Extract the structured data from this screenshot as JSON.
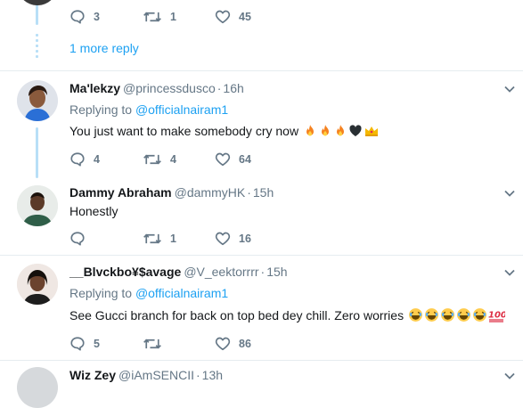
{
  "top_tweet": {
    "counts": {
      "reply": "3",
      "retweet": "1",
      "like": "45"
    },
    "more_reply_label": "1 more reply"
  },
  "tweets": [
    {
      "name": "Ma'lekzy",
      "handle": "@princessdusco",
      "dot": "·",
      "time": "16h",
      "replying_prefix": "Replying to",
      "replying_to": "@officialnairam1",
      "text": "You just want to make somebody cry now",
      "emoji": [
        "fire",
        "fire",
        "fire",
        "black-heart",
        "crown"
      ],
      "counts": {
        "reply": "4",
        "retweet": "4",
        "like": "64"
      }
    },
    {
      "name": "Dammy Abraham",
      "handle": "@dammyHK",
      "dot": "·",
      "time": "15h",
      "text": "Honestly",
      "counts": {
        "reply": "",
        "retweet": "1",
        "like": "16"
      }
    },
    {
      "name": "__Blvckbo¥$avage",
      "handle": "@V_eektorrrr",
      "dot": "·",
      "time": "15h",
      "replying_prefix": "Replying to",
      "replying_to": "@officialnairam1",
      "text": "See Gucci branch for back on top bed dey chill. Zero worries",
      "emoji": [
        "joy",
        "joy",
        "joy",
        "joy",
        "joy",
        "hundred"
      ],
      "counts": {
        "reply": "5",
        "retweet": "",
        "like": "86"
      }
    },
    {
      "name": "Wiz Zey",
      "handle": "@iAmSENCII",
      "dot": "·",
      "time": "13h"
    }
  ],
  "colors": {
    "accent": "#1da1f2",
    "muted": "#657786",
    "thread_line": "#b8dff7",
    "divider": "#e6ecf0"
  }
}
